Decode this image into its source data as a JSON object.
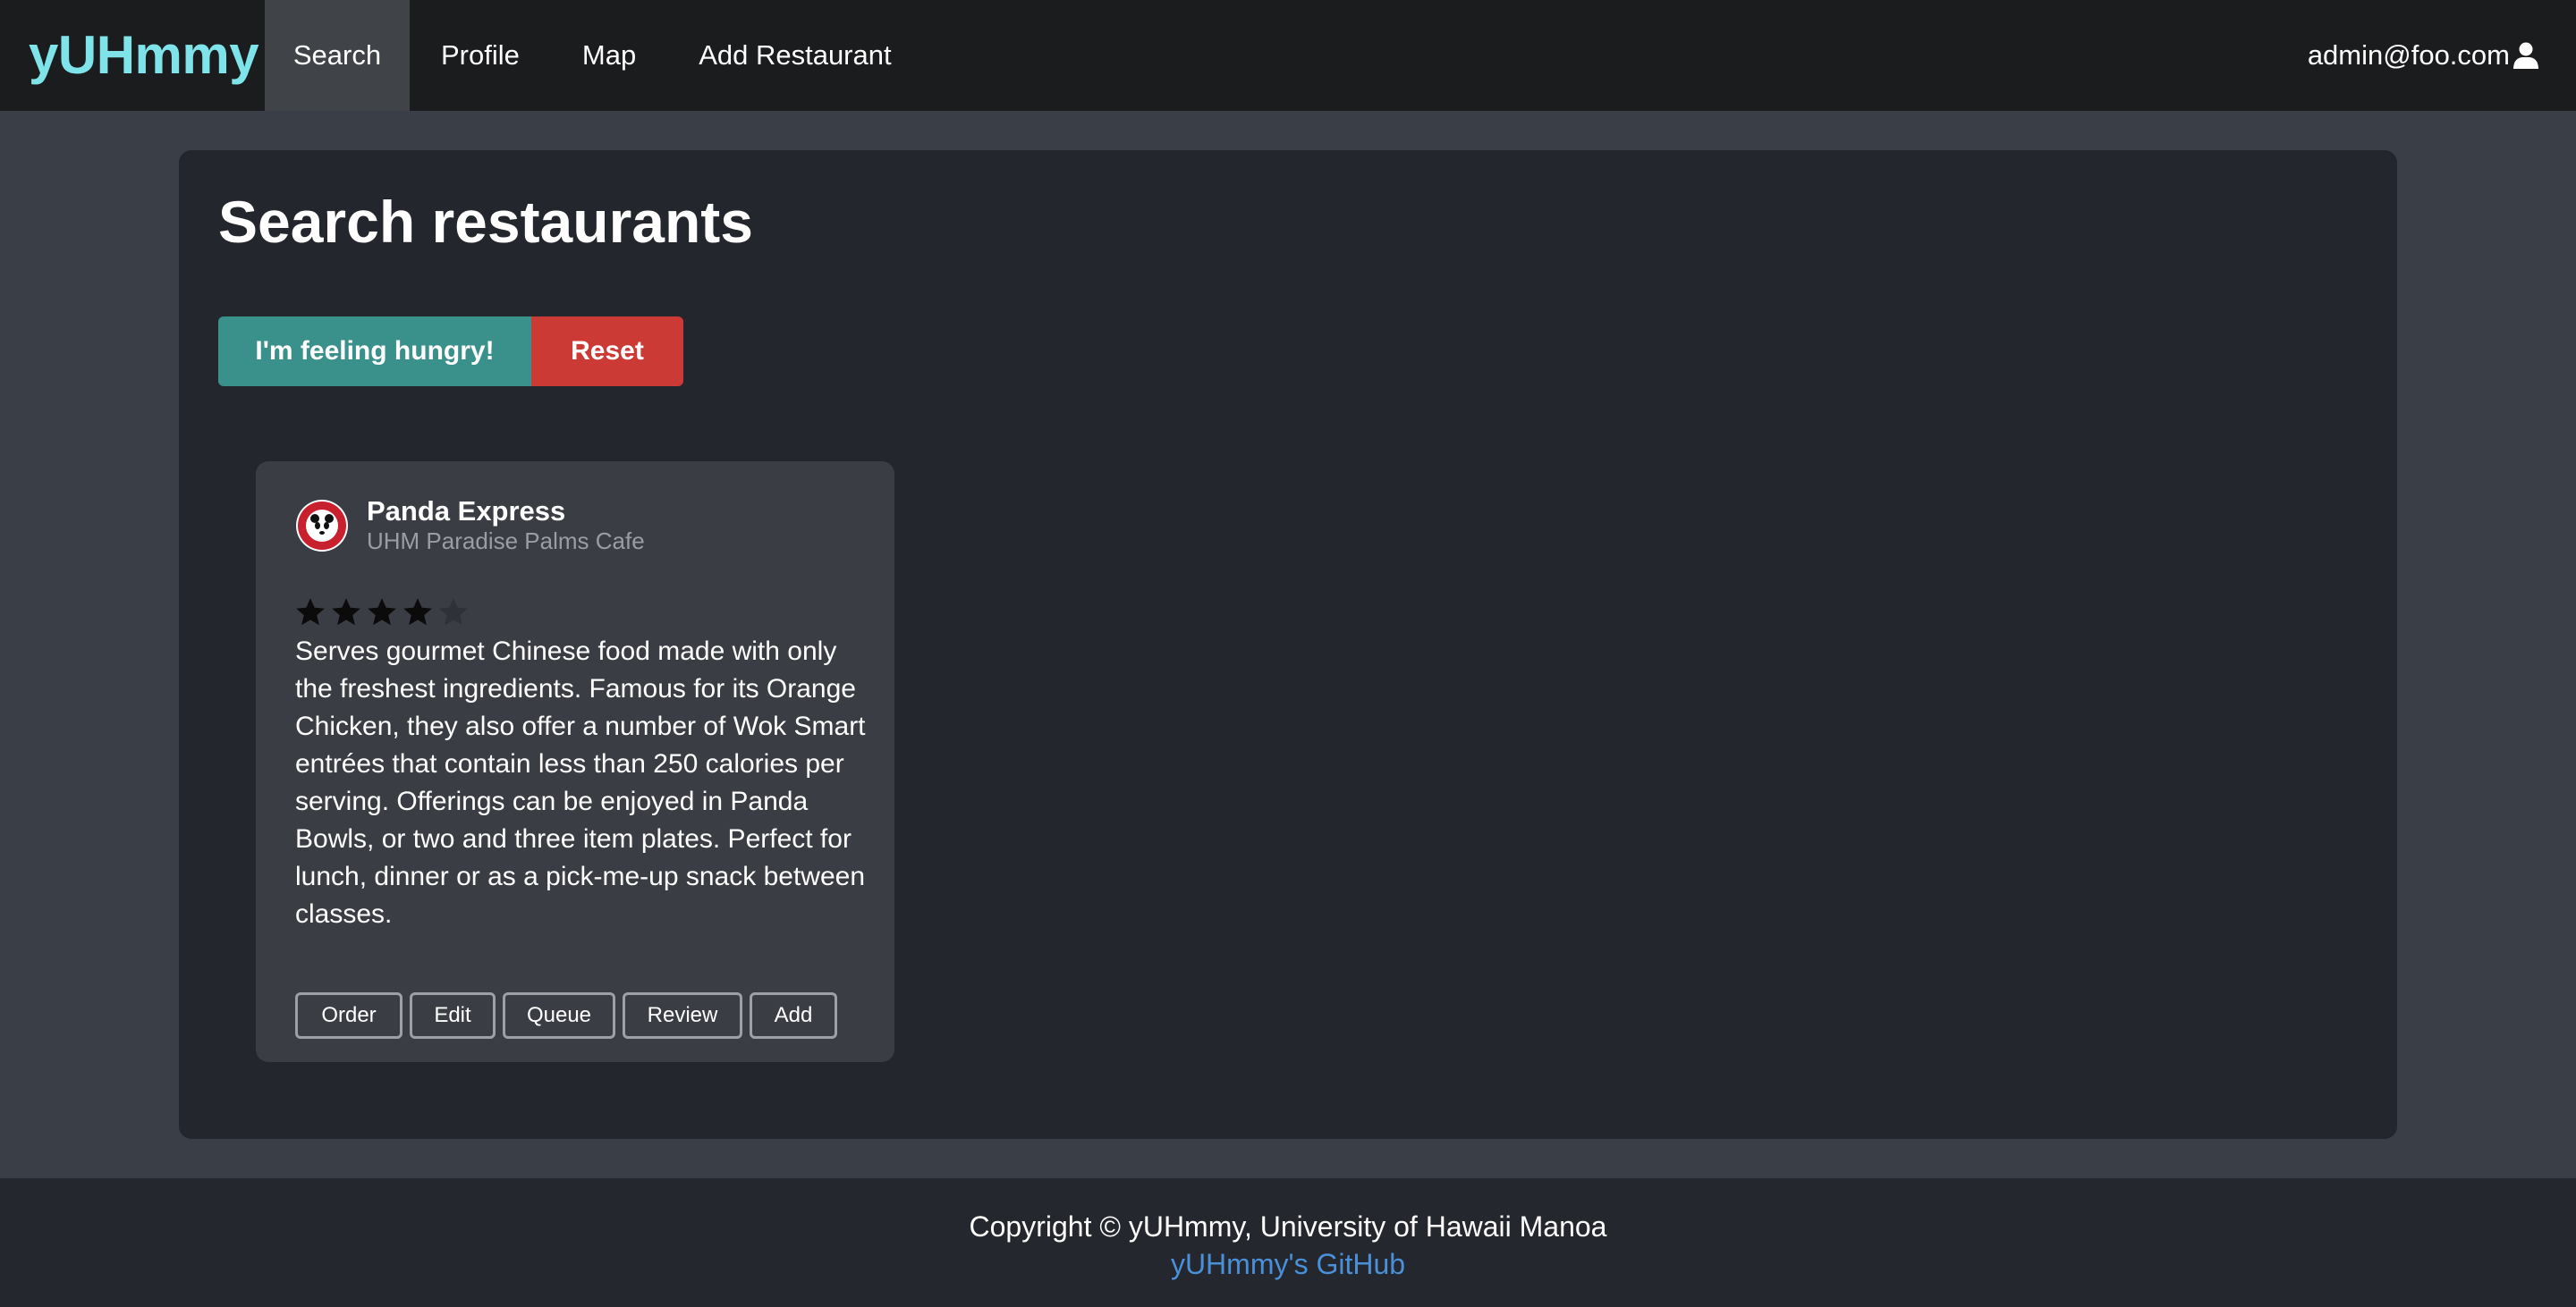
{
  "nav": {
    "brand": "yUHmmy",
    "items": [
      {
        "label": "Search",
        "active": true
      },
      {
        "label": "Profile"
      },
      {
        "label": "Map"
      },
      {
        "label": "Add Restaurant"
      }
    ],
    "user": "admin@foo.com",
    "user_icon": "user-icon"
  },
  "page": {
    "title": "Search restaurants",
    "hungry_label": "I'm feeling hungry!",
    "reset_label": "Reset",
    "colors": {
      "hungry": "#3a918c",
      "reset": "#cc3a35",
      "brand": "#7fe3ea",
      "link": "#4a90d9"
    }
  },
  "restaurant": {
    "name": "Panda Express",
    "location": "UHM Paradise Palms Cafe",
    "logo_icon": "panda-express-logo",
    "rating": 4,
    "rating_max": 5,
    "description": "Serves gourmet Chinese food made with only the freshest ingredients. Famous for its Orange Chicken, they also offer a number of Wok Smart entrées that contain less than 250 calories per serving. Offerings can be enjoyed in Panda Bowls, or two and three item plates. Perfect for lunch, dinner or as a pick-me-up snack between classes.",
    "actions": [
      "Order",
      "Edit",
      "Queue",
      "Review",
      "Add"
    ]
  },
  "footer": {
    "copyright": "Copyright © yUHmmy, University of Hawaii Manoa",
    "github_link": "yUHmmy's GitHub"
  }
}
